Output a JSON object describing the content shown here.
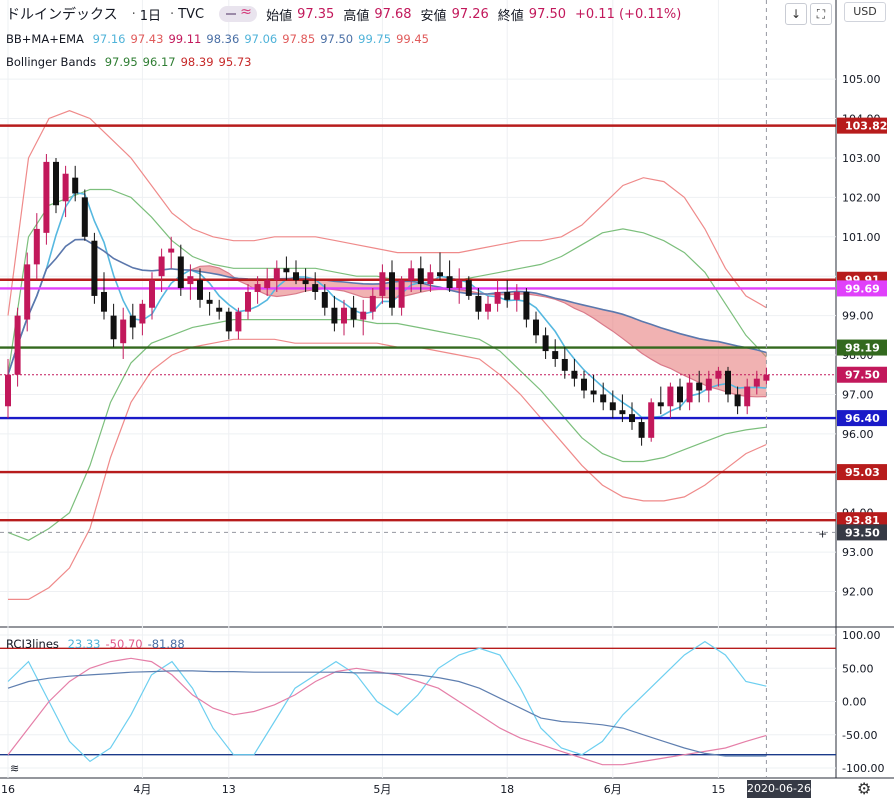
{
  "header": {
    "symbol": "ドルインデックス",
    "sep1": "·",
    "interval": "1日",
    "sep2": "·",
    "source": "TVC",
    "ohlc": [
      {
        "label": "始値",
        "value": "97.35"
      },
      {
        "label": "高値",
        "value": "97.68"
      },
      {
        "label": "安値",
        "value": "97.26"
      },
      {
        "label": "終値",
        "value": "97.50"
      }
    ],
    "change": "+0.11 (+0.11%)",
    "currency": "USD",
    "btn_down": "↓",
    "btn_full": "⛶"
  },
  "legend_bbma": {
    "name": "BB+MA+EMA",
    "values": [
      {
        "v": "97.16",
        "color": "#4fb3d9"
      },
      {
        "v": "97.43",
        "color": "#e05a5a"
      },
      {
        "v": "99.11",
        "color": "#c2185b"
      },
      {
        "v": "98.36",
        "color": "#4a6fa5"
      },
      {
        "v": "97.06",
        "color": "#4fb3d9"
      },
      {
        "v": "97.85",
        "color": "#e05a5a"
      },
      {
        "v": "97.50",
        "color": "#4a6fa5"
      },
      {
        "v": "99.75",
        "color": "#4fb3d9"
      },
      {
        "v": "99.45",
        "color": "#e05a5a"
      }
    ]
  },
  "legend_bb": {
    "name": "Bollinger Bands",
    "values": [
      {
        "v": "97.95",
        "color": "#2e7d32"
      },
      {
        "v": "96.17",
        "color": "#2e7d32"
      },
      {
        "v": "98.39",
        "color": "#c62828"
      },
      {
        "v": "95.73",
        "color": "#c62828"
      }
    ]
  },
  "legend_rci": {
    "name": "RCI3lines",
    "values": [
      {
        "v": "23.33",
        "color": "#4fb3d9"
      },
      {
        "v": "-50.70",
        "color": "#e05a8a"
      },
      {
        "v": "-81.88",
        "color": "#4a6fa5"
      }
    ]
  },
  "date_badge": "2020-06-26",
  "chart_data": [
    {
      "type": "candlestick",
      "price_axis": {
        "ylim": [
          91.1,
          106.5
        ],
        "ticks": [
          {
            "v": 92,
            "label": "92.00"
          },
          {
            "v": 93,
            "label": "93.00"
          },
          {
            "v": 94,
            "label": "94.00"
          },
          {
            "v": 95,
            "label": "95.00"
          },
          {
            "v": 96,
            "label": "96.00"
          },
          {
            "v": 97,
            "label": "97.00"
          },
          {
            "v": 98,
            "label": "98.00"
          },
          {
            "v": 99,
            "label": "99.00"
          },
          {
            "v": 100,
            "label": "100.00"
          },
          {
            "v": 101,
            "label": "101.00"
          },
          {
            "v": 102,
            "label": "102.00"
          },
          {
            "v": 103,
            "label": "103.00"
          },
          {
            "v": 104,
            "label": "104.00"
          },
          {
            "v": 105,
            "label": "105.00"
          }
        ]
      },
      "time_axis": {
        "ticks": [
          "16",
          "4月",
          "13",
          "5月",
          "18",
          "6月",
          "15"
        ],
        "tick_index": [
          0,
          14,
          23,
          39,
          52,
          63,
          74
        ]
      },
      "candles": [
        [
          96.7,
          97.9,
          96.4,
          97.5
        ],
        [
          97.5,
          99.2,
          97.2,
          99.0
        ],
        [
          98.9,
          100.6,
          98.6,
          100.3
        ],
        [
          100.3,
          101.6,
          99.9,
          101.2
        ],
        [
          101.1,
          103.1,
          100.8,
          102.9
        ],
        [
          102.9,
          103.0,
          101.6,
          101.8
        ],
        [
          101.9,
          102.8,
          101.5,
          102.6
        ],
        [
          102.5,
          102.8,
          101.9,
          102.1
        ],
        [
          102.0,
          102.2,
          100.9,
          101.0
        ],
        [
          100.9,
          101.1,
          99.3,
          99.5
        ],
        [
          99.6,
          100.1,
          98.9,
          99.1
        ],
        [
          99.0,
          99.3,
          98.2,
          98.4
        ],
        [
          98.3,
          99.2,
          97.9,
          98.9
        ],
        [
          99.0,
          99.3,
          98.4,
          98.7
        ],
        [
          98.8,
          99.4,
          98.5,
          99.3
        ],
        [
          99.2,
          100.1,
          98.9,
          99.9
        ],
        [
          100.0,
          100.7,
          99.6,
          100.5
        ],
        [
          100.6,
          101.0,
          100.2,
          100.7
        ],
        [
          100.5,
          100.8,
          99.5,
          99.7
        ],
        [
          99.8,
          100.3,
          99.4,
          100.0
        ],
        [
          99.9,
          100.2,
          99.2,
          99.4
        ],
        [
          99.4,
          99.6,
          99.0,
          99.3
        ],
        [
          99.2,
          99.4,
          98.9,
          99.1
        ],
        [
          99.1,
          99.2,
          98.4,
          98.6
        ],
        [
          98.6,
          99.2,
          98.4,
          99.1
        ],
        [
          99.1,
          99.8,
          98.9,
          99.6
        ],
        [
          99.6,
          100.0,
          99.3,
          99.8
        ],
        [
          99.7,
          100.2,
          99.5,
          99.9
        ],
        [
          99.9,
          100.4,
          99.6,
          100.2
        ],
        [
          100.2,
          100.5,
          99.9,
          100.1
        ],
        [
          100.1,
          100.4,
          99.8,
          99.9
        ],
        [
          99.9,
          100.2,
          99.6,
          99.8
        ],
        [
          99.8,
          100.1,
          99.4,
          99.6
        ],
        [
          99.6,
          99.8,
          99.0,
          99.2
        ],
        [
          99.2,
          99.5,
          98.6,
          98.8
        ],
        [
          98.8,
          99.4,
          98.5,
          99.2
        ],
        [
          99.2,
          99.5,
          98.7,
          98.9
        ],
        [
          98.9,
          99.4,
          98.5,
          99.1
        ],
        [
          99.1,
          99.7,
          98.9,
          99.5
        ],
        [
          99.5,
          100.3,
          99.3,
          100.1
        ],
        [
          100.1,
          100.4,
          99.0,
          99.2
        ],
        [
          99.2,
          100.0,
          99.0,
          99.9
        ],
        [
          99.9,
          100.4,
          99.6,
          100.2
        ],
        [
          100.2,
          100.5,
          99.6,
          99.8
        ],
        [
          99.8,
          100.3,
          99.6,
          100.1
        ],
        [
          100.1,
          100.6,
          99.9,
          100.0
        ],
        [
          100.0,
          100.4,
          99.6,
          99.7
        ],
        [
          99.7,
          100.2,
          99.3,
          99.9
        ],
        [
          99.9,
          100.0,
          99.4,
          99.5
        ],
        [
          99.5,
          99.7,
          98.9,
          99.1
        ],
        [
          99.1,
          99.5,
          98.9,
          99.3
        ],
        [
          99.3,
          99.9,
          99.1,
          99.6
        ],
        [
          99.6,
          99.9,
          99.2,
          99.4
        ],
        [
          99.4,
          99.8,
          99.1,
          99.6
        ],
        [
          99.6,
          99.7,
          98.7,
          98.9
        ],
        [
          98.9,
          99.1,
          98.3,
          98.5
        ],
        [
          98.5,
          98.7,
          97.9,
          98.1
        ],
        [
          98.1,
          98.4,
          97.7,
          97.9
        ],
        [
          97.9,
          98.2,
          97.4,
          97.6
        ],
        [
          97.6,
          97.9,
          97.2,
          97.4
        ],
        [
          97.4,
          97.6,
          96.9,
          97.1
        ],
        [
          97.1,
          97.5,
          96.8,
          97.0
        ],
        [
          97.0,
          97.3,
          96.6,
          96.8
        ],
        [
          96.8,
          97.1,
          96.4,
          96.6
        ],
        [
          96.6,
          97.0,
          96.3,
          96.5
        ],
        [
          96.5,
          96.8,
          96.1,
          96.3
        ],
        [
          96.3,
          96.4,
          95.7,
          95.9
        ],
        [
          95.9,
          96.9,
          95.8,
          96.8
        ],
        [
          96.8,
          97.2,
          96.5,
          96.7
        ],
        [
          96.7,
          97.3,
          96.4,
          97.2
        ],
        [
          97.2,
          97.4,
          96.6,
          96.8
        ],
        [
          96.8,
          97.5,
          96.6,
          97.3
        ],
        [
          97.3,
          97.6,
          96.8,
          97.1
        ],
        [
          97.1,
          97.6,
          96.8,
          97.4
        ],
        [
          97.4,
          97.7,
          97.2,
          97.6
        ],
        [
          97.6,
          97.7,
          96.8,
          97.0
        ],
        [
          97.0,
          97.2,
          96.5,
          96.7
        ],
        [
          96.7,
          97.4,
          96.5,
          97.2
        ],
        [
          97.2,
          97.6,
          97.0,
          97.4
        ],
        [
          97.35,
          97.68,
          97.26,
          97.5
        ]
      ],
      "bb_outer_upper": [
        99.0,
        103.0,
        104.0,
        104.2,
        104.0,
        103.5,
        103.0,
        102.3,
        101.6,
        101.2,
        101.0,
        100.9,
        100.9,
        101.0,
        101.0,
        101.0,
        100.9,
        100.8,
        100.7,
        100.6,
        100.6,
        100.6,
        100.6,
        100.7,
        100.8,
        100.9,
        100.9,
        101.0,
        101.3,
        101.8,
        102.3,
        102.5,
        102.4,
        102.0,
        101.2,
        100.2,
        99.5,
        99.2
      ],
      "bb_outer_lower": [
        91.8,
        91.8,
        92.1,
        92.6,
        93.6,
        95.4,
        96.8,
        97.6,
        98.0,
        98.2,
        98.3,
        98.4,
        98.4,
        98.4,
        98.3,
        98.3,
        98.3,
        98.3,
        98.3,
        98.2,
        98.2,
        98.1,
        98.0,
        97.9,
        97.5,
        97.0,
        96.4,
        95.8,
        95.2,
        94.7,
        94.4,
        94.3,
        94.3,
        94.4,
        94.7,
        95.1,
        95.5,
        95.73
      ],
      "bb_inner_upper": [
        97.5,
        101.0,
        101.8,
        102.0,
        102.2,
        102.2,
        102.0,
        101.5,
        100.9,
        100.5,
        100.3,
        100.2,
        100.2,
        100.2,
        100.2,
        100.2,
        100.1,
        100.0,
        100.0,
        99.9,
        99.9,
        99.9,
        99.9,
        100.0,
        100.1,
        100.2,
        100.3,
        100.5,
        100.8,
        101.1,
        101.2,
        101.1,
        100.9,
        100.6,
        100.1,
        99.3,
        98.5,
        97.95
      ],
      "bb_inner_lower": [
        93.5,
        93.3,
        93.6,
        94.0,
        95.2,
        96.8,
        97.8,
        98.3,
        98.5,
        98.7,
        98.8,
        98.9,
        98.9,
        98.9,
        98.9,
        98.9,
        98.9,
        98.9,
        98.8,
        98.8,
        98.7,
        98.6,
        98.5,
        98.4,
        98.1,
        97.6,
        97.1,
        96.5,
        95.9,
        95.5,
        95.3,
        95.3,
        95.4,
        95.6,
        95.8,
        96.0,
        96.1,
        96.17
      ],
      "horizontal_levels": [
        {
          "v": 103.82,
          "label": "103.82",
          "color": "#b71c1c"
        },
        {
          "v": 99.91,
          "label": "99.91",
          "color": "#b71c1c"
        },
        {
          "v": 99.69,
          "label": "99.69",
          "color": "#e040fb"
        },
        {
          "v": 98.19,
          "label": "98.19",
          "color": "#33691e"
        },
        {
          "v": 97.5,
          "label": "97.50",
          "color": "#c2185b"
        },
        {
          "v": 96.4,
          "label": "96.40",
          "color": "#1a1ac8"
        },
        {
          "v": 95.03,
          "label": "95.03",
          "color": "#b71c1c"
        },
        {
          "v": 93.81,
          "label": "93.81",
          "color": "#b71c1c"
        }
      ],
      "crosshair": {
        "v": 93.5,
        "label": "93.50"
      }
    },
    {
      "type": "line",
      "name": "RCI3lines",
      "ylim": [
        -100,
        100
      ],
      "ticks": [
        {
          "v": 100,
          "label": "100.00"
        },
        {
          "v": 50,
          "label": "50.00"
        },
        {
          "v": 0,
          "label": "0.00"
        },
        {
          "v": -50,
          "label": "-50.00"
        },
        {
          "v": -100,
          "label": "-100.00"
        }
      ],
      "levels": [
        80,
        -80
      ],
      "series": [
        {
          "color": "#6dcff0",
          "values": [
            30,
            60,
            0,
            -60,
            -90,
            -70,
            -20,
            40,
            60,
            20,
            -40,
            -80,
            -80,
            -30,
            20,
            40,
            60,
            40,
            0,
            -20,
            10,
            50,
            70,
            80,
            70,
            20,
            -40,
            -70,
            -80,
            -60,
            -20,
            10,
            40,
            70,
            90,
            70,
            30,
            23
          ]
        },
        {
          "color": "#e57fa8",
          "values": [
            -80,
            -40,
            0,
            30,
            50,
            60,
            65,
            60,
            40,
            10,
            -10,
            -20,
            -15,
            -5,
            10,
            30,
            45,
            50,
            45,
            40,
            30,
            20,
            0,
            -20,
            -40,
            -55,
            -65,
            -75,
            -85,
            -95,
            -95,
            -90,
            -85,
            -80,
            -75,
            -70,
            -60,
            -51
          ]
        },
        {
          "color": "#5f7fb0",
          "values": [
            20,
            30,
            35,
            38,
            40,
            42,
            44,
            45,
            46,
            46,
            45,
            45,
            44,
            44,
            44,
            44,
            44,
            43,
            43,
            42,
            40,
            36,
            30,
            20,
            5,
            -10,
            -25,
            -30,
            -32,
            -35,
            -40,
            -50,
            -60,
            -70,
            -78,
            -82,
            -82,
            -82
          ]
        }
      ]
    }
  ]
}
